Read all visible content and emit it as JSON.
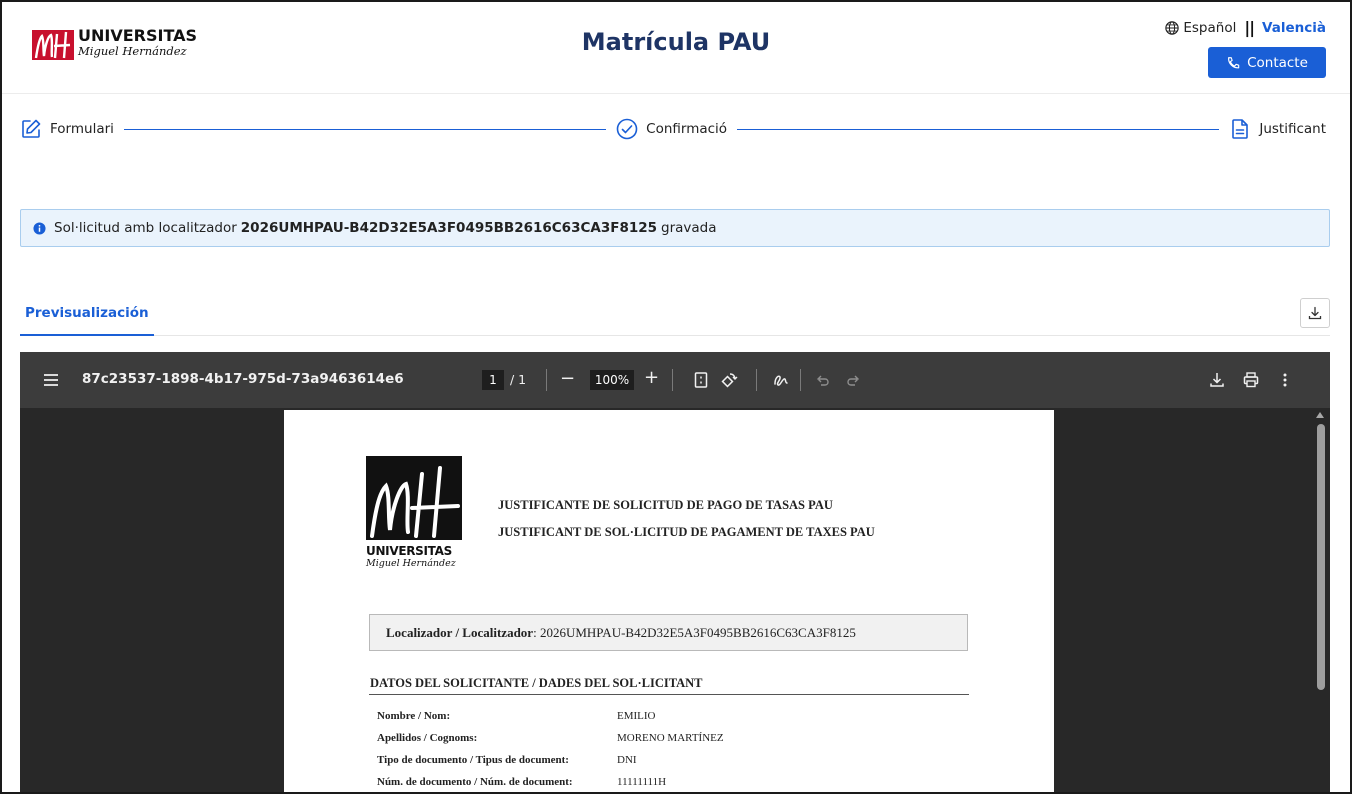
{
  "header": {
    "logo_line1": "UNIVERSITAS",
    "logo_line2": "Miguel Hernández",
    "title": "Matrícula PAU",
    "lang_es": "Español",
    "lang_sep": "||",
    "lang_va": "Valencià",
    "contact_label": "Contacte"
  },
  "stepper": {
    "steps": [
      {
        "label": "Formulari",
        "icon": "edit-icon"
      },
      {
        "label": "Confirmació",
        "icon": "check-circle-icon"
      },
      {
        "label": "Justificant",
        "icon": "document-icon"
      }
    ]
  },
  "alert": {
    "prefix": "Sol·licitud amb localitzador",
    "locator": "2026UMHPAU-B42D32E5A3F0495BB2616C63CA3F8125",
    "suffix": "gravada"
  },
  "tabs": {
    "active_label": "Previsualización"
  },
  "viewer": {
    "filename": "87c23537-1898-4b17-975d-73a9463614e6",
    "page_current": "1",
    "page_total": "/ 1",
    "zoom": "100%",
    "minus": "−",
    "plus": "+"
  },
  "pdf": {
    "logo_line1": "UNIVERSITAS",
    "logo_line2": "Miguel Hernández",
    "title_es": "JUSTIFICANTE DE SOLICITUD DE PAGO DE TASAS PAU",
    "title_va": "JUSTIFICANT DE SOL·LICITUD DE PAGAMENT DE TAXES PAU",
    "locator_label": "Localizador / Localitzador",
    "locator_value": ": 2026UMHPAU-B42D32E5A3F0495BB2616C63CA3F8125",
    "section_title": "DATOS DEL SOLICITANTE / DADES DEL SOL·LICITANT",
    "rows": [
      {
        "label": "Nombre / Nom:",
        "value": "EMILIO"
      },
      {
        "label": "Apellidos / Cognoms:",
        "value": "MORENO MARTÍNEZ"
      },
      {
        "label": "Tipo de documento / Tipus de document:",
        "value": "DNI"
      },
      {
        "label": "Núm. de documento / Núm. de document:",
        "value": "11111111H"
      }
    ]
  },
  "colors": {
    "accent": "#1a5fd6",
    "title": "#1e3465",
    "alert_bg": "#eaf3fc",
    "viewer_bg": "#282828",
    "toolbar_bg": "#3c3c3c"
  }
}
